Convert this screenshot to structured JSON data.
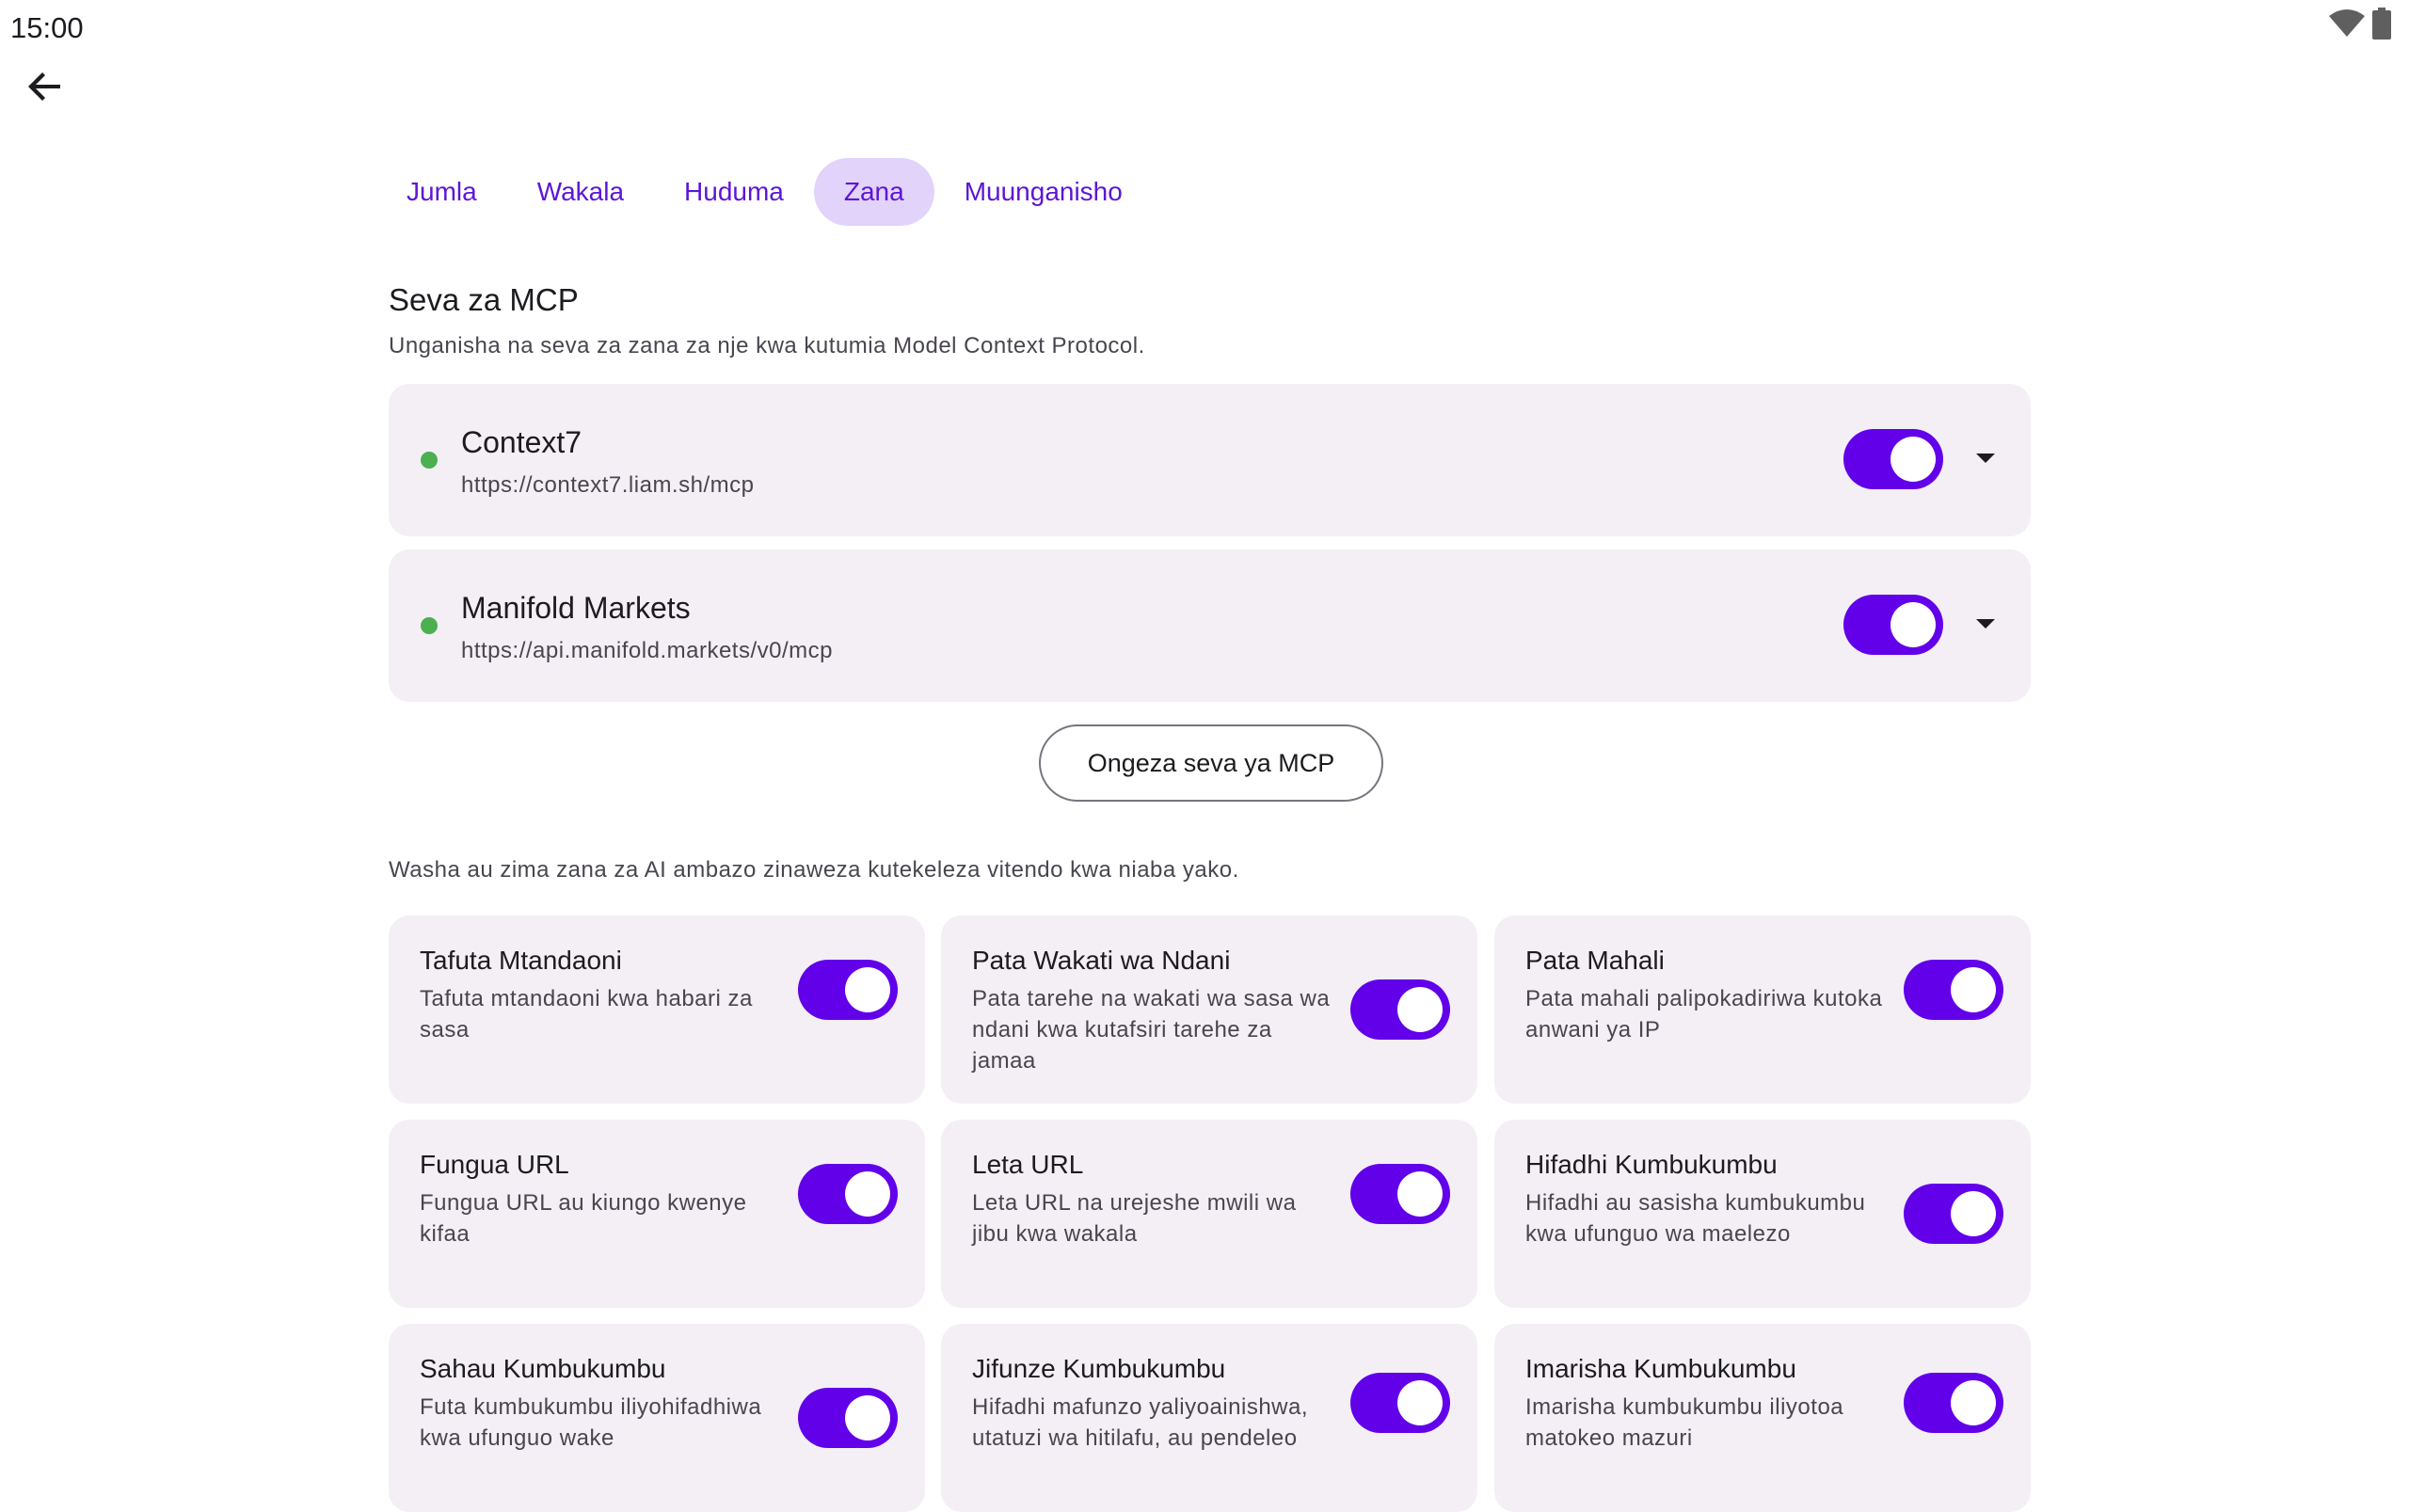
{
  "status_bar": {
    "time": "15:00",
    "icons": [
      "wifi-icon",
      "battery-icon"
    ]
  },
  "header": {
    "back_icon": "arrow-back-icon"
  },
  "tabs": [
    {
      "label": "Jumla",
      "active": false
    },
    {
      "label": "Wakala",
      "active": false
    },
    {
      "label": "Huduma",
      "active": false
    },
    {
      "label": "Zana",
      "active": true
    },
    {
      "label": "Muunganisho",
      "active": false
    }
  ],
  "mcp": {
    "title": "Seva za MCP",
    "description": "Unganisha na seva za zana za nje kwa kutumia Model Context Protocol.",
    "servers": [
      {
        "name": "Context7",
        "url": "https://context7.liam.sh/mcp",
        "connected": true,
        "enabled": true
      },
      {
        "name": "Manifold Markets",
        "url": "https://api.manifold.markets/v0/mcp",
        "connected": true,
        "enabled": true
      }
    ],
    "add_button": "Ongeza seva ya MCP"
  },
  "tools": {
    "description": "Washa au zima zana za AI ambazo zinaweza kutekeleza vitendo kwa niaba yako.",
    "items": [
      {
        "title": "Tafuta Mtandaoni",
        "description": "Tafuta mtandaoni kwa habari za sasa",
        "enabled": true
      },
      {
        "title": "Pata Wakati wa Ndani",
        "description": "Pata tarehe na wakati wa sasa wa ndani kwa kutafsiri tarehe za jamaa",
        "enabled": true
      },
      {
        "title": "Pata Mahali",
        "description": "Pata mahali palipokadiriwa kutoka anwani ya IP",
        "enabled": true
      },
      {
        "title": "Fungua URL",
        "description": "Fungua URL au kiungo kwenye kifaa",
        "enabled": true
      },
      {
        "title": "Leta URL",
        "description": "Leta URL na urejeshe mwili wa jibu kwa wakala",
        "enabled": true
      },
      {
        "title": "Hifadhi Kumbukumbu",
        "description": "Hifadhi au sasisha kumbukumbu kwa ufunguo wa maelezo",
        "enabled": true
      },
      {
        "title": "Sahau Kumbukumbu",
        "description": "Futa kumbukumbu iliyohifadhiwa kwa ufunguo wake",
        "enabled": true
      },
      {
        "title": "Jifunze Kumbukumbu",
        "description": "Hifadhi mafunzo yaliyoainishwa, utatuzi wa hitilafu, au pendeleo",
        "enabled": true
      },
      {
        "title": "Imarisha Kumbukumbu",
        "description": "Imarisha kumbukumbu iliyotoa matokeo mazuri",
        "enabled": true
      }
    ]
  },
  "colors": {
    "accent": "#6200ea",
    "tab_text": "#5d15d6",
    "tab_active_bg": "#e2d3fa",
    "card_bg": "#f3eff5",
    "status_dot": "#4caf50"
  }
}
